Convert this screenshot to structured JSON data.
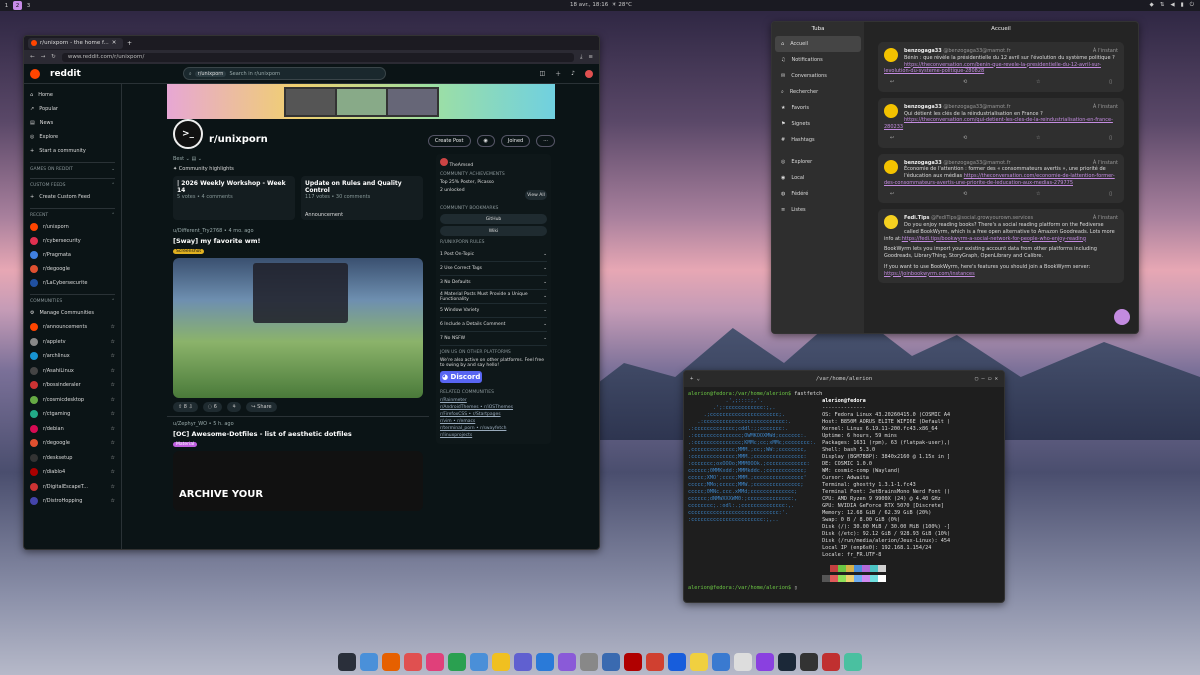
{
  "topbar": {
    "workspaces": [
      "1",
      "2",
      "3"
    ],
    "active": "2",
    "clock": "18 avr., 18:16",
    "weather": "☀ 28°C"
  },
  "browser": {
    "tab_title": "r/unixporn - the home f...",
    "url": "www.reddit.com/r/unixporn/",
    "logo": "reddit",
    "search_chip": "r/unixporn",
    "search_placeholder": "Search in r/unixporn",
    "nav": [
      "Home",
      "Popular",
      "News",
      "Explore",
      "Start a community"
    ],
    "sections": {
      "games": "GAMES ON REDDIT",
      "custom": "CUSTOM FEEDS",
      "recent": "RECENT",
      "communities": "COMMUNITIES"
    },
    "create_feed": "Create Custom Feed",
    "recent": [
      "r/unixporn",
      "r/cybersecurity",
      "r/Pragmata",
      "r/degoogle",
      "r/LaCybersecurite"
    ],
    "manage": "Manage Communities",
    "communities": [
      "r/announcements",
      "r/appletv",
      "r/archlinux",
      "r/AsahiLinux",
      "r/bossinderaler",
      "r/cosmicdesktop",
      "r/ctgaming",
      "r/debian",
      "r/degoogle",
      "r/desksetup",
      "r/diablo4",
      "r/DigitalEscapeT...",
      "r/DistroHopping"
    ],
    "sub_name": "r/unixporn",
    "create_post": "Create Post",
    "joined": "Joined",
    "sort": "Best",
    "highlights_label": "Community highlights",
    "highlights": [
      {
        "title": "| 2026 Weekly Workshop - Week 14",
        "meta": "5 votes • 4 comments"
      },
      {
        "title": "Update on Rules and Quality Control",
        "meta": "117 votes • 30 comments",
        "tag": "Announcement"
      }
    ],
    "post1": {
      "author": "u/Different_Try2768 • 4 mo. ago",
      "title": "[Sway] my favorite wm!",
      "flair": "Screenshot",
      "votes": "8",
      "comments": "6",
      "share": "Share"
    },
    "post2": {
      "author": "u/Zephyr_WO • 5 h. ago",
      "title": "[OC] Awesome-Dotfiles - list of aesthetic dotfiles",
      "flair": "Material",
      "img_text": "ARCHIVE YOUR"
    },
    "right": {
      "user": "TheAmsed",
      "achievements_h": "COMMUNITY ACHIEVEMENTS",
      "achievement": "Top 25% Poster, Picasso",
      "unlocked": "2 unlocked",
      "view_all": "View All",
      "bookmarks_h": "COMMUNITY BOOKMARKS",
      "bookmarks": [
        "GitHub",
        "Wiki"
      ],
      "rules_h": "R/UNIXPORN RULES",
      "rules": [
        "1 Post On-Topic",
        "2 Use Correct Tags",
        "3 No Defaults",
        "4 Material Posts Must Provide a Unique Functionality",
        "5 Window Variety",
        "6 Include a Details Comment",
        "7 No NSFW"
      ],
      "join_h": "JOIN US ON OTHER PLATFORMS",
      "join_text": "We're also active on other platforms. Feel free to swing by and say hello!",
      "discord": "Discord",
      "related_h": "RELATED COMMUNITIES",
      "related": [
        "r/Rainmeter",
        "r/AndroidThemes • r/iOSThemes",
        "r/FirefoxCSS • r/Startpages",
        "r/vim • r/emacs",
        "r/terminal_porn • r/swayfetch",
        "r/linuxprojects"
      ]
    }
  },
  "tuba": {
    "app": "Tuba",
    "title": "Accueil",
    "nav": [
      "Accueil",
      "Notifications",
      "Conversations",
      "Rechercher",
      "Favoris",
      "Signets",
      "Hashtags",
      "Explorer",
      "Local",
      "Fédéré",
      "Listes"
    ],
    "posts": [
      {
        "name": "benzogaga33",
        "handle": "@benzogaga33@mamot.fr",
        "time": "À l'instant",
        "text": "Bénin : que révèle la présidentielle du 12 avril sur l'évolution du système politique ? ",
        "link": "https://theconversation.com/benin-que-revele-la-presidentielle-du-12-avril-sur-levolution-du-systeme-politique-280828"
      },
      {
        "name": "benzogaga33",
        "handle": "@benzogaga33@mamot.fr",
        "time": "À l'instant",
        "text": "Qui détient les clés de la réindustrialisation en France ? ",
        "link": "https://theconversation.com/qui-detient-les-cles-de-la-reindustrialisation-en-france-280233"
      },
      {
        "name": "benzogaga33",
        "handle": "@benzogaga33@mamot.fr",
        "time": "À l'instant",
        "text": "Économie de l'attention : former des « consommateurs avertis », une priorité de l'éducation aux médias ",
        "link": "https://theconversation.com/economie-de-lattention-former-des-consommateurs-avertis-une-priorite-de-leducation-aux-medias-279775"
      },
      {
        "name": "Fedi.Tips",
        "handle": "@FediTips@social.growyourown.services",
        "time": "À l'instant",
        "text": "Do you enjoy reading books? There's a social reading platform on the Fediverse called BookWyrm, which is a free open alternative to Amazon Goodreads. Lots more info at:",
        "link": "https://fedi.tips/bookwyrm-a-social-network-for-people-who-enjoy-reading",
        "text2": "BookWyrm lets you import your existing account data from other platforms including Goodreads, LibraryThing, StoryGraph, OpenLibrary and Calibre.",
        "text3": "If you want to use BookWyrm, here's features you should join a BookWyrm server:",
        "link2": "https://joinbookwyrm.com/instances"
      }
    ]
  },
  "terminal": {
    "title": "/var/home/alerion",
    "prompt": "alerion@fedora:/var/home/alerion$ ",
    "cmd": "fastfetch",
    "ascii": [
      "            .',;::::;,'.",
      "        .';:cccccccccccc:;,.",
      "     .;cccccccccccccccccccccc;.",
      "   .:cccccccccccccccccccccccccc:.",
      ".:ccccccccccccc;cddl:;;ccccccc:.",
      ".:ccccccccccccccc;OWMKOOXMWd;ccccccc:.",
      ".:ccccccccccccccc;KMMc;cc;xMMc;cccccccc:.",
      ",cccccccccccccc;MMM.;cc;;WW:;cccccccc,",
      ":cccccccccccccc;MMM.;cccccccccccccccc:",
      ":ccccccc;oxOOOo;MMM0OOk.;ccccccccccccc:",
      "cccccc;0MMKxdd:;MMMkddc.;cccccccccccc;",
      "ccccc;XMO';cccc;MMM.;cccccccccccccccc'",
      "ccccc;MMo;ccccc;MMW.;ccccccccccccccc;",
      "ccccc;0MNc.ccc.xMMd;cccccccccccccc;",
      "cccccc;dNMWXXXWM0:;cccccccccccccc:,",
      "cccccccc;.:odl:.;cccccccccccccc:,.",
      "ccccccccccccccccccccccccccccc:'.",
      ":ccccccccccccccccccccccc:;,.."
    ],
    "user": "alerion@fedora",
    "sep": "--------------",
    "info": [
      "OS: Fedora Linux 43.20260415.0 (COSMIC A4",
      "Host: B850M AORUS ELITE WIFI6E (Default )",
      "Kernel: Linux 6.19.11-200.fc43.x86_64",
      "Uptime: 6 hours, 59 mins",
      "Packages: 1631 (rpm), 63 (flatpak-user),)",
      "Shell: bash 5.3.0",
      "Display (BGM7B8P): 3840x2160 @ 1.15x in ]",
      "DE: COSMIC 1.0.0",
      "WM: cosmic-comp (Wayland)",
      "Cursor: Adwaita",
      "Terminal: ghostty 1.3.1-1.fc43",
      "Terminal Font: JetBrainsMono Nerd Font ()",
      "CPU: AMD Ryzen 9 9900X (24) @ 4.40 GHz",
      "GPU: NVIDIA GeForce RTX 5070 [Discrete]",
      "Memory: 12.68 GiB / 62.39 GiB (20%)",
      "Swap: 0 B / 8.00 GiB (0%)",
      "Disk (/): 30.00 MiB / 30.00 MiB (100%) -]",
      "Disk (/etc): 92.12 GiB / 928.93 GiB (10%)",
      "Disk (/run/media/alerion/Jeux-Linux): 454",
      "Local IP (enp6s0): 192.168.1.154/24",
      "Locale: fr_FR.UTF-8"
    ],
    "palette": [
      "#1e1e1e",
      "#c34040",
      "#6cc644",
      "#d8b048",
      "#4c8fd8",
      "#b36ad8",
      "#4cc4c4",
      "#d0d0d0",
      "#555555",
      "#e05a5a",
      "#8ee05a",
      "#f0d070",
      "#70aef0",
      "#d08af0",
      "#70e0e0",
      "#ffffff"
    ]
  },
  "dock": {
    "icons": [
      "terminal-icon",
      "files-icon",
      "firefox-icon",
      "app-icon",
      "app-icon",
      "app-icon",
      "app-icon",
      "app-icon",
      "app-icon",
      "vscode-icon",
      "app-icon",
      "app-icon",
      "app-icon",
      "filezilla-icon",
      "app-icon",
      "bitwarden-icon",
      "app-icon",
      "app-icon",
      "app-icon",
      "app-icon",
      "steam-icon",
      "app-icon",
      "app-icon",
      "app-icon"
    ],
    "colors": [
      "#2a2f3a",
      "#4a90d9",
      "#e66000",
      "#e05050",
      "#e0407a",
      "#2aa050",
      "#4a8fd8",
      "#f0c020",
      "#6060d0",
      "#2a7ad8",
      "#8a5ad8",
      "#888",
      "#3a6ab0",
      "#b00000",
      "#d04030",
      "#175ddc",
      "#f0d040",
      "#3a7ad0",
      "#ddd",
      "#8a40e0",
      "#1b2838",
      "#333",
      "#c03030",
      "#4ac0a0"
    ]
  }
}
